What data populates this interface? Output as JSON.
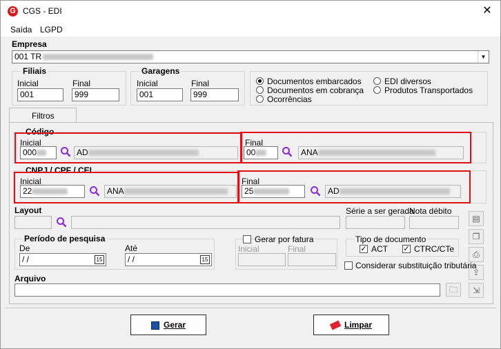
{
  "window": {
    "title": "CGS - EDI",
    "close": "✕",
    "logo_letter": "G"
  },
  "menu": {
    "items": [
      "Saída",
      "LGPD"
    ]
  },
  "empresa": {
    "label": "Empresa",
    "value": "001 TR"
  },
  "filiais": {
    "label": "Filiais",
    "inicial_label": "Inicial",
    "final_label": "Final",
    "inicial": "001",
    "final": "999"
  },
  "garagens": {
    "label": "Garagens",
    "inicial_label": "Inicial",
    "final_label": "Final",
    "inicial": "001",
    "final": "999"
  },
  "options": {
    "radio": [
      "Documentos embarcados",
      "Documentos em cobrança",
      "Ocorrências",
      "EDI diversos",
      "Produtos Transportados"
    ],
    "selected": "Documentos embarcados"
  },
  "tabs": {
    "filtros": "Filtros"
  },
  "codigo": {
    "label": "Código",
    "inicial_label": "Inicial",
    "final_label": "Final",
    "inicial_code": "000",
    "inicial_name": "AD",
    "final_code": "00",
    "final_name": "ANA"
  },
  "cnpj": {
    "label": "CNPJ / CPF / CEI",
    "inicial_label": "Inicial",
    "final_label": "Final",
    "inicial_code": "22",
    "inicial_name": "ANA",
    "final_code": "25",
    "final_name": "AD"
  },
  "layout": {
    "label": "Layout",
    "serie_label": "Série a ser gerada",
    "nota_label": "Nota débito"
  },
  "periodo": {
    "label": "Período de pesquisa",
    "de_label": "De",
    "ate_label": "Até",
    "de": " / /",
    "ate": " / /",
    "cal": "15"
  },
  "fatura": {
    "label": "Gerar por fatura",
    "inicial_label": "Inicial",
    "final_label": "Final"
  },
  "tipo_doc": {
    "label": "Tipo de documento",
    "act": "ACT",
    "ctrc": "CTRC/CTe"
  },
  "substituicao": {
    "label": "Considerar substituição tributária"
  },
  "arquivo": {
    "label": "Arquivo"
  },
  "buttons": {
    "gerar": "Gerar",
    "limpar": "Limpar"
  },
  "colors": {
    "highlight": "#e01010",
    "search_icon": "#8a2be2"
  }
}
